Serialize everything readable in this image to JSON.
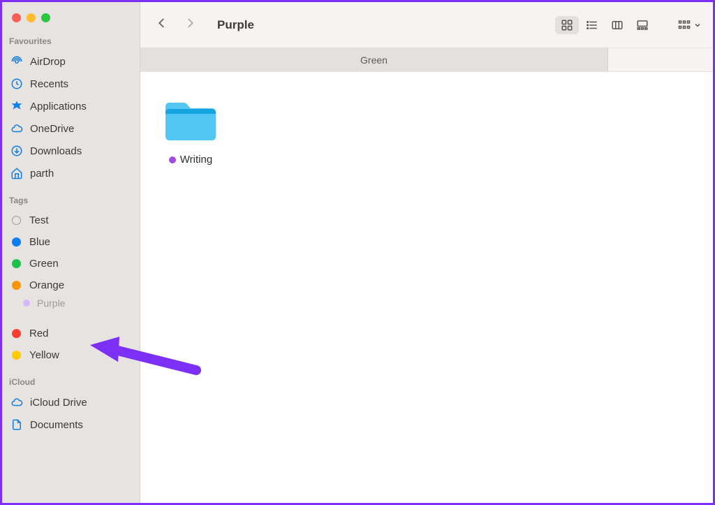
{
  "window": {
    "title": "Purple"
  },
  "tabs": [
    {
      "label": "Green"
    }
  ],
  "sidebar": {
    "sections": [
      {
        "heading": "Favourites",
        "items": [
          {
            "label": "AirDrop"
          },
          {
            "label": "Recents"
          },
          {
            "label": "Applications"
          },
          {
            "label": "OneDrive"
          },
          {
            "label": "Downloads"
          },
          {
            "label": "parth"
          }
        ]
      },
      {
        "heading": "Tags",
        "items": [
          {
            "label": "Test"
          },
          {
            "label": "Blue"
          },
          {
            "label": "Green"
          },
          {
            "label": "Orange"
          },
          {
            "label": "Purple"
          },
          {
            "label": "Red"
          },
          {
            "label": "Yellow"
          }
        ]
      },
      {
        "heading": "iCloud",
        "items": [
          {
            "label": "iCloud Drive"
          },
          {
            "label": "Documents"
          }
        ]
      }
    ]
  },
  "content": {
    "items": [
      {
        "name": "Writing",
        "tagColor": "#a24bde"
      }
    ]
  },
  "colors": {
    "blue": "#0a7ff5",
    "green": "#1cc24a",
    "orange": "#ff9500",
    "red": "#ff3b30",
    "yellow": "#ffcc00"
  }
}
